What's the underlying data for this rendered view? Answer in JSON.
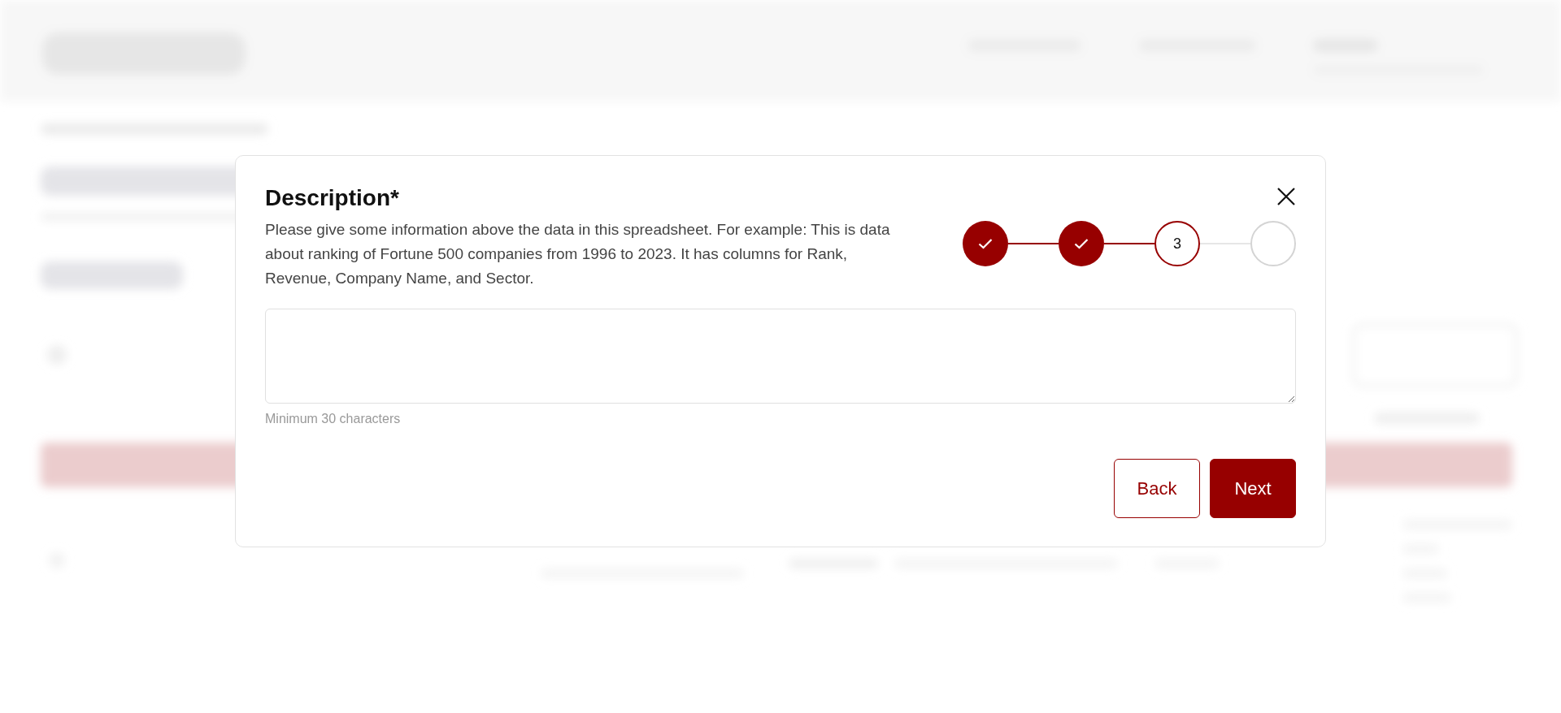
{
  "dialog": {
    "title": "Description*",
    "description": "Please give some information above the data in this spreadsheet. For example: This is data about ranking of Fortune 500 companies from 1996 to 2023. It has columns for Rank, Revenue, Company Name, and Sector.",
    "steps": [
      {
        "kind": "done"
      },
      {
        "kind": "done"
      },
      {
        "kind": "current",
        "label": "3"
      },
      {
        "kind": "upcoming"
      }
    ],
    "field": {
      "hint": "Minimum 30 characters"
    },
    "buttons": [
      {
        "label": "Back",
        "kind": "secondary"
      },
      {
        "label": "Next",
        "kind": "primary"
      }
    ]
  }
}
